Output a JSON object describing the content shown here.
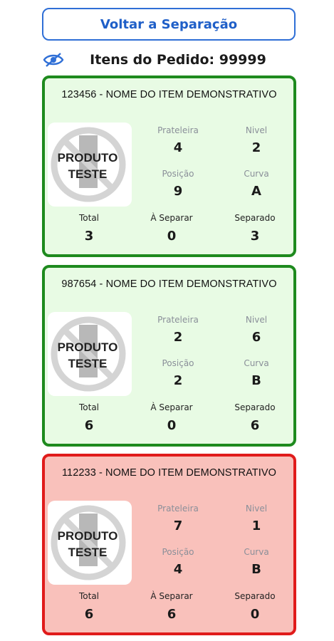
{
  "header": {
    "back_label": "Voltar a Separação",
    "order_title": "Itens do Pedido: 99999"
  },
  "image_text": {
    "line1": "PRODUTO",
    "line2": "TESTE"
  },
  "labels": {
    "shelf": "Prateleira",
    "level": "Nivel",
    "position": "Posição",
    "curve": "Curva",
    "total": "Total",
    "to_separate": "À Separar",
    "separated": "Separado"
  },
  "items": [
    {
      "title": "123456 - NOME DO ITEM DEMONSTRATIVO",
      "shelf": "4",
      "level": "2",
      "position": "9",
      "curve": "A",
      "total": "3",
      "to_separate": "0",
      "separated": "3",
      "status": "complete"
    },
    {
      "title": "987654 - NOME DO ITEM DEMONSTRATIVO",
      "shelf": "2",
      "level": "6",
      "position": "2",
      "curve": "B",
      "total": "6",
      "to_separate": "0",
      "separated": "6",
      "status": "complete"
    },
    {
      "title": "112233 - NOME DO ITEM DEMONSTRATIVO",
      "shelf": "7",
      "level": "1",
      "position": "4",
      "curve": "B",
      "total": "6",
      "to_separate": "6",
      "separated": "0",
      "status": "pending"
    }
  ],
  "colors": {
    "accent": "#1f5fc8",
    "complete_border": "#1e8a1e",
    "complete_bg": "#e8fbe4",
    "pending_border": "#e01b1b",
    "pending_bg": "#f9c1bb"
  }
}
